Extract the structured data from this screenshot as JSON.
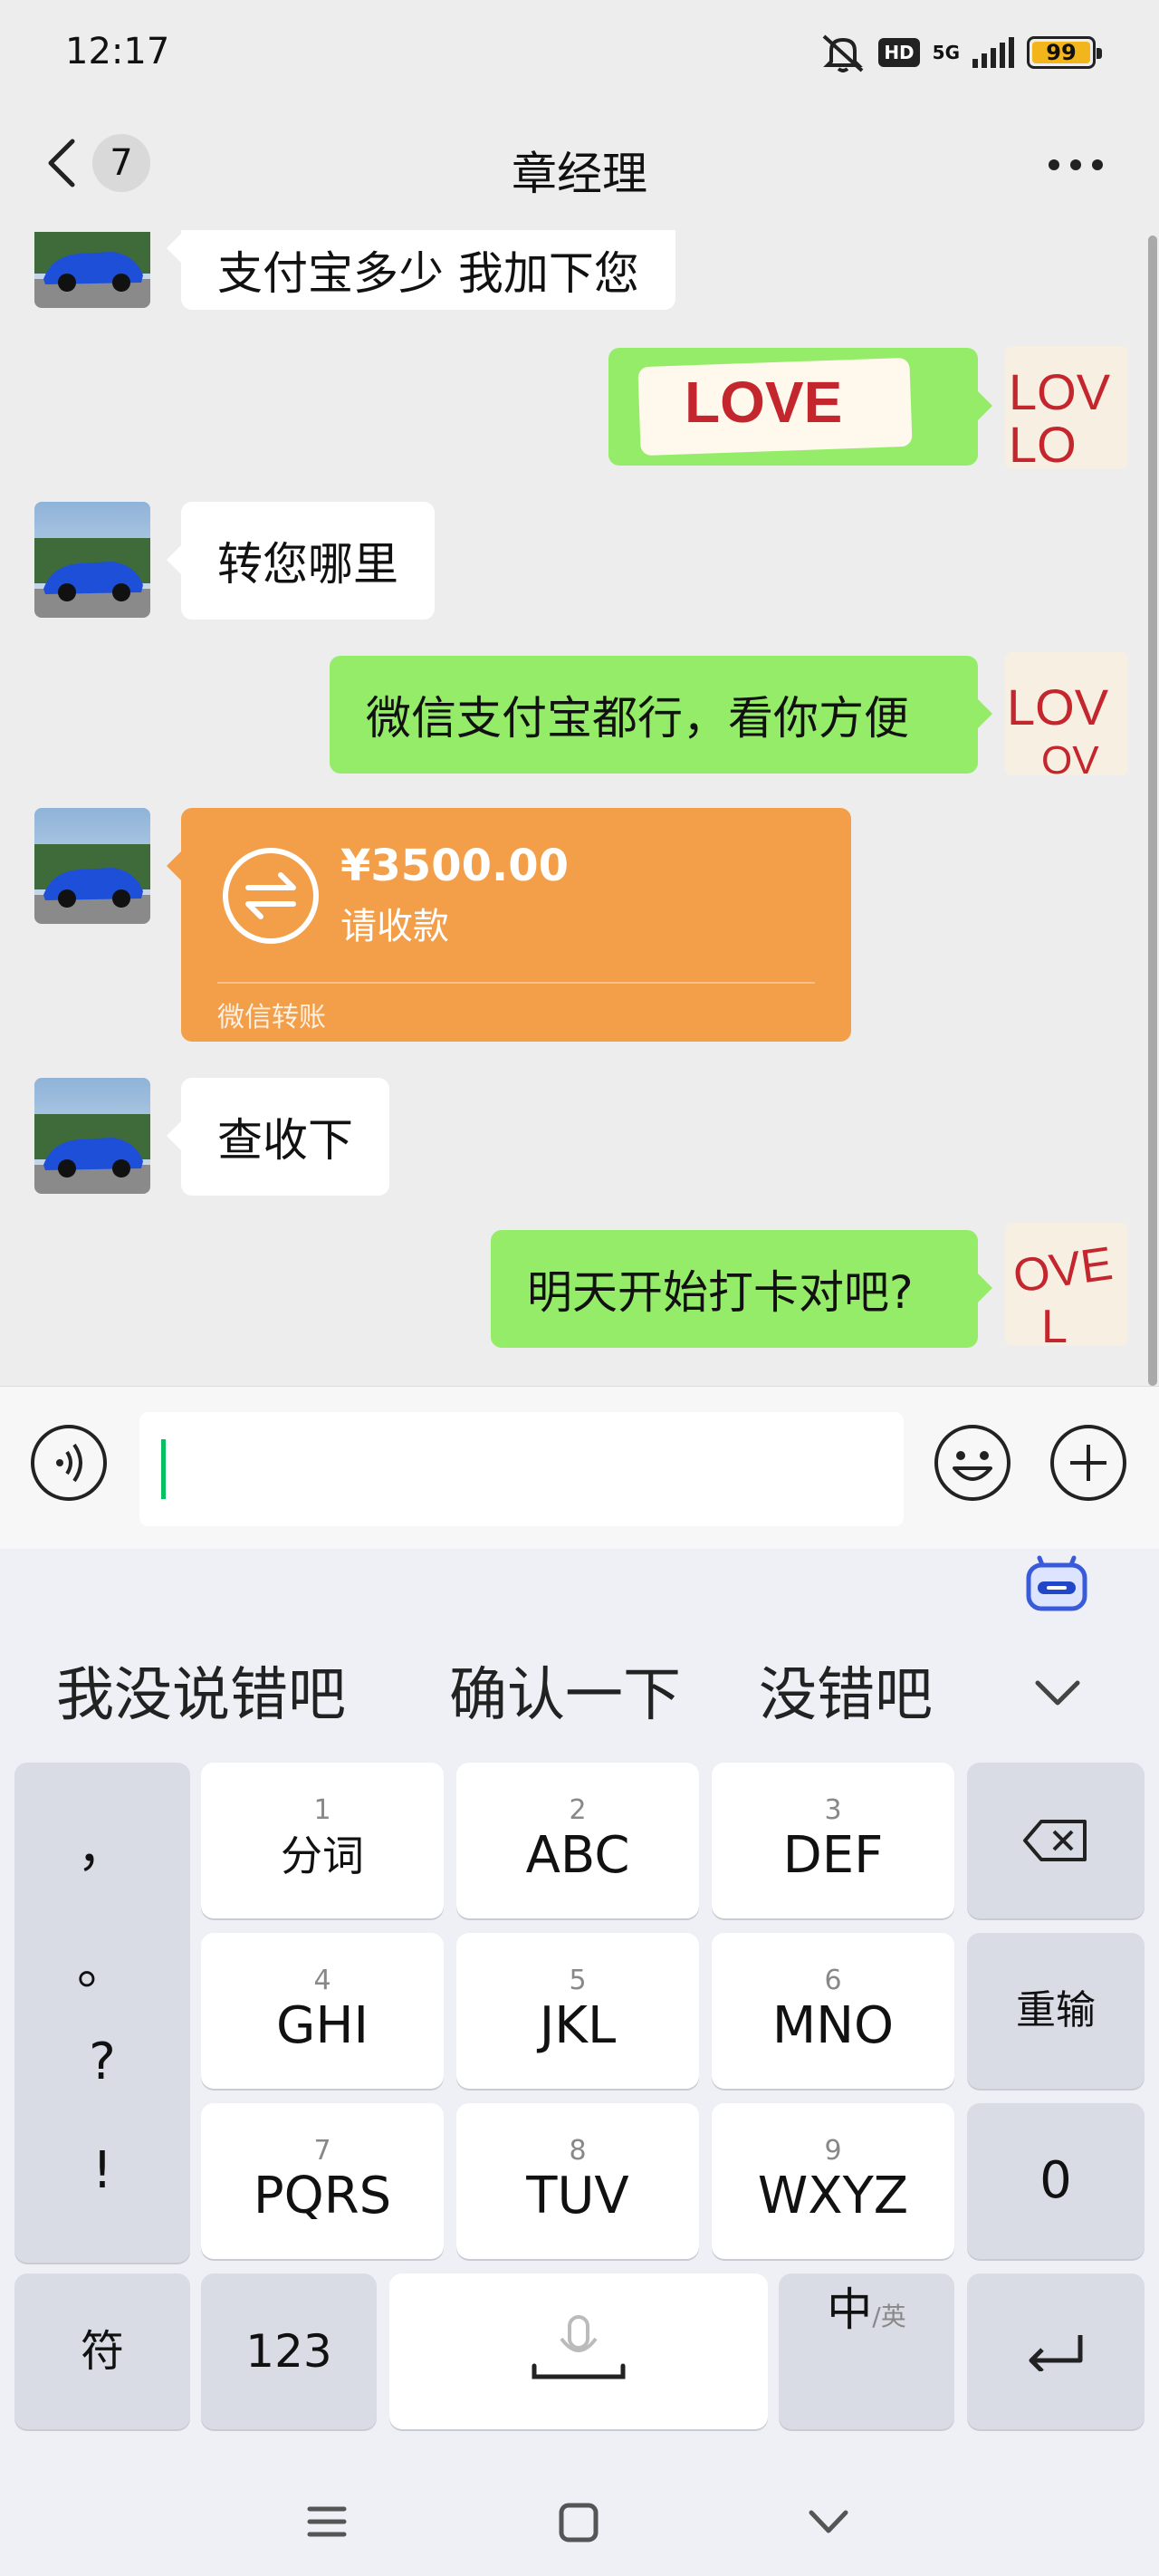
{
  "status_bar": {
    "time": "12:17",
    "hd": "HD",
    "network": "5G",
    "battery": "99"
  },
  "header": {
    "unread_count": "7",
    "title": "章经理"
  },
  "messages": [
    {
      "side": "left",
      "text": "支付宝多少  我加下您"
    },
    {
      "side": "right",
      "type": "sticker",
      "text": "LOVE"
    },
    {
      "side": "left",
      "text": "转您哪里"
    },
    {
      "side": "right",
      "text": "微信支付宝都行，看你方便"
    },
    {
      "side": "left",
      "type": "transfer",
      "amount": "¥3500.00",
      "status": "请收款",
      "footer": "微信转账"
    },
    {
      "side": "left",
      "text": "查收下"
    },
    {
      "side": "right",
      "text": "明天开始打卡对吧?"
    }
  ],
  "input": {
    "value": ""
  },
  "keyboard": {
    "suggestions": [
      "我没说错吧",
      "确认一下",
      "没错吧"
    ],
    "punct": [
      "，",
      "。",
      "?",
      "!"
    ],
    "keys": [
      {
        "num": "1",
        "label": "分词"
      },
      {
        "num": "2",
        "label": "ABC"
      },
      {
        "num": "3",
        "label": "DEF"
      },
      {
        "num": "4",
        "label": "GHI"
      },
      {
        "num": "5",
        "label": "JKL"
      },
      {
        "num": "6",
        "label": "MNO"
      },
      {
        "num": "7",
        "label": "PQRS"
      },
      {
        "num": "8",
        "label": "TUV"
      },
      {
        "num": "9",
        "label": "WXYZ"
      }
    ],
    "reinput": "重输",
    "zero": "0",
    "symbol": "符",
    "num_mode": "123",
    "lang_main": "中",
    "lang_alt": "/英"
  }
}
